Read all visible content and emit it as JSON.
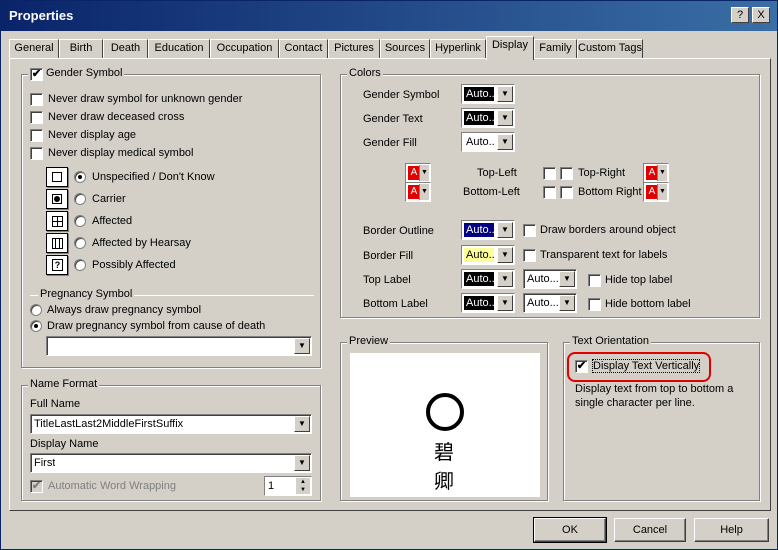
{
  "window": {
    "title": "Properties",
    "help_button": "?",
    "close_button": "X"
  },
  "tabs": [
    "General",
    "Birth",
    "Death",
    "Education",
    "Occupation",
    "Contact",
    "Pictures",
    "Sources",
    "Hyperlink",
    "Display",
    "Family",
    "Custom Tags"
  ],
  "active_tab": "Display",
  "gender": {
    "group_label": "Gender Symbol",
    "group_checked": true,
    "options": [
      {
        "label": "Never draw symbol for unknown gender",
        "checked": false
      },
      {
        "label": "Never draw deceased cross",
        "checked": false
      },
      {
        "label": "Never display age",
        "checked": false
      },
      {
        "label": "Never display medical symbol",
        "checked": false
      }
    ],
    "status": [
      {
        "label": "Unspecified / Don't Know",
        "selected": true,
        "icon": "empty-square-icon"
      },
      {
        "label": "Carrier",
        "selected": false,
        "icon": "carrier-dot-icon"
      },
      {
        "label": "Affected",
        "selected": false,
        "icon": "quartered-square-icon"
      },
      {
        "label": "Affected by Hearsay",
        "selected": false,
        "icon": "hearsay-square-icon"
      },
      {
        "label": "Possibly Affected",
        "selected": false,
        "icon": "question-square-icon"
      }
    ]
  },
  "pregnancy": {
    "label": "Pregnancy Symbol",
    "always": "Always draw pregnancy symbol",
    "from_cause": "Draw pregnancy symbol from cause of death",
    "selected": "from_cause",
    "combo_value": ""
  },
  "name_format": {
    "group_label": "Name Format",
    "full_name_label": "Full Name",
    "full_name_value": "TitleLastLast2MiddleFirstSuffix",
    "display_name_label": "Display Name",
    "display_name_value": "First",
    "wrap_label": "Automatic Word Wrapping",
    "wrap_checked": true,
    "wrap_value": "1"
  },
  "colors": {
    "group_label": "Colors",
    "gender_symbol": {
      "label": "Gender Symbol",
      "value": "Auto...",
      "color": "#000000"
    },
    "gender_text": {
      "label": "Gender Text",
      "value": "Auto...",
      "color": "#000000"
    },
    "gender_fill": {
      "label": "Gender Fill",
      "value": "Auto..."
    },
    "corners": {
      "top_left": "Top-Left",
      "top_right": "Top-Right",
      "bottom_left": "Bottom-Left",
      "bottom_right": "Bottom Right",
      "letter": "A",
      "color": "#e00000"
    },
    "border_outline": {
      "label": "Border Outline",
      "value": "Auto...",
      "color": "#000080"
    },
    "border_fill": {
      "label": "Border Fill",
      "value": "Auto...",
      "color": "#ffff99"
    },
    "top_label": {
      "label": "Top Label",
      "value": "Auto...",
      "value2": "Auto...",
      "color": "#000000"
    },
    "bottom_label": {
      "label": "Bottom Label",
      "value": "Auto...",
      "value2": "Auto...",
      "color": "#000000"
    },
    "draw_borders": "Draw borders around object",
    "transparent_text": "Transparent text for labels",
    "hide_top": "Hide top label",
    "hide_bottom": "Hide bottom label"
  },
  "preview": {
    "label": "Preview",
    "char1": "碧",
    "char2": "卿"
  },
  "text_orientation": {
    "group_label": "Text Orientation",
    "checkbox_label": "Display Text Vertically",
    "checked": true,
    "description": "Display text from top to bottom a single character per line."
  },
  "buttons": {
    "ok": "OK",
    "cancel": "Cancel",
    "help": "Help"
  },
  "highlight_color": "#e00000"
}
